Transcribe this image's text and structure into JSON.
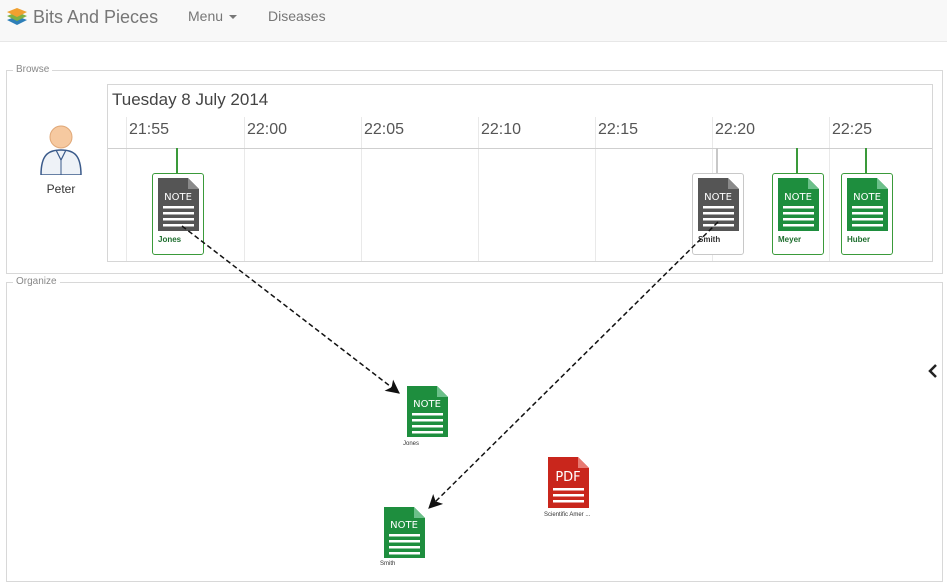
{
  "navbar": {
    "brand": "Bits And Pieces",
    "menu_label": "Menu",
    "diseases_label": "Diseases"
  },
  "browse": {
    "legend": "Browse",
    "person_name": "Peter",
    "timeline": {
      "date": "Tuesday 8 July 2014",
      "ticks": [
        "21:55",
        "22:00",
        "22:05",
        "22:10",
        "22:15",
        "22:20",
        "22:25"
      ],
      "items": [
        {
          "label": "Jones",
          "icon_text": "NOTE",
          "state": "active"
        },
        {
          "label": "Smith",
          "icon_text": "NOTE",
          "state": "inactive"
        },
        {
          "label": "Meyer",
          "icon_text": "NOTE",
          "state": "active"
        },
        {
          "label": "Huber",
          "icon_text": "NOTE",
          "state": "active"
        }
      ]
    }
  },
  "organize": {
    "legend": "Organize",
    "items": [
      {
        "label": "Jones",
        "icon_text": "NOTE",
        "type": "note"
      },
      {
        "label": "Scientific Amer ...",
        "icon_text": "PDF",
        "type": "pdf"
      },
      {
        "label": "Smith",
        "icon_text": "NOTE",
        "type": "note"
      }
    ]
  },
  "colors": {
    "note_green": "#1e8e3e",
    "note_gray": "#555555",
    "pdf_red": "#c9261c",
    "active_border": "#3a9a3a",
    "inactive_border": "#c8c8c8"
  }
}
